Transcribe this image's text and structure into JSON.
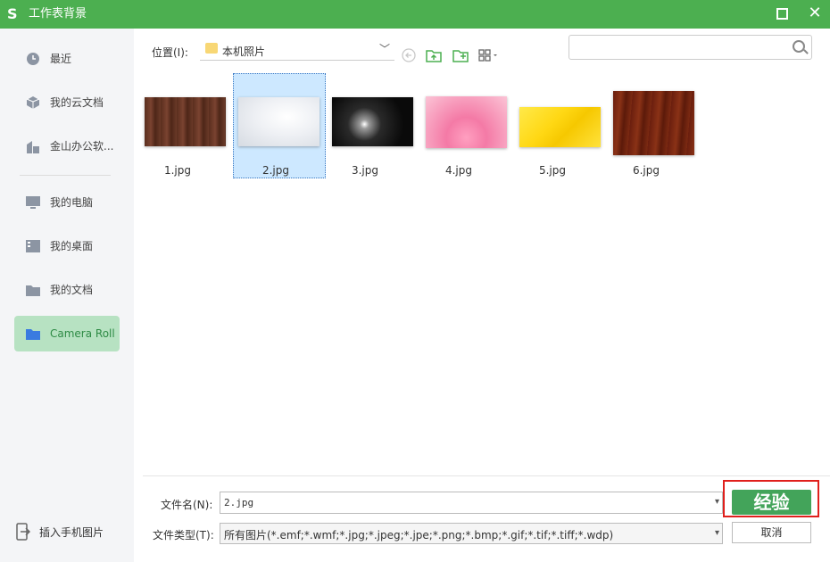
{
  "window": {
    "logo": "S",
    "title": "工作表背景",
    "close": "✕"
  },
  "sidebar": {
    "items": [
      {
        "label": "最近",
        "icon": "clock-icon"
      },
      {
        "label": "我的云文档",
        "icon": "cloud-box-icon"
      },
      {
        "label": "金山办公软...",
        "icon": "building-icon"
      },
      {
        "label": "我的电脑",
        "icon": "monitor-icon"
      },
      {
        "label": "我的桌面",
        "icon": "desktop-icon"
      },
      {
        "label": "我的文档",
        "icon": "folder-icon"
      },
      {
        "label": "Camera Roll",
        "icon": "folder-icon"
      }
    ],
    "bottom_label": "插入手机图片"
  },
  "toolbar": {
    "location_label": "位置(I):",
    "location_value": "本机照片",
    "location_arrow": "﹀"
  },
  "files": [
    {
      "name": "1.jpg"
    },
    {
      "name": "2.jpg"
    },
    {
      "name": "3.jpg"
    },
    {
      "name": "4.jpg"
    },
    {
      "name": "5.jpg"
    },
    {
      "name": "6.jpg"
    }
  ],
  "footer": {
    "filename_label": "文件名(N):",
    "filename_value": "2.jpg",
    "filetype_label": "文件类型(T):",
    "filetype_value": "所有图片(*.emf;*.wmf;*.jpg;*.jpeg;*.jpe;*.png;*.bmp;*.gif;*.tif;*.tiff;*.wdp)",
    "open_label": "经验",
    "cancel_label": "取消",
    "arrow": "▾"
  },
  "colors": {
    "accent": "#4caf50",
    "open_button": "#43a45a",
    "highlight_frame": "#e0201c"
  }
}
